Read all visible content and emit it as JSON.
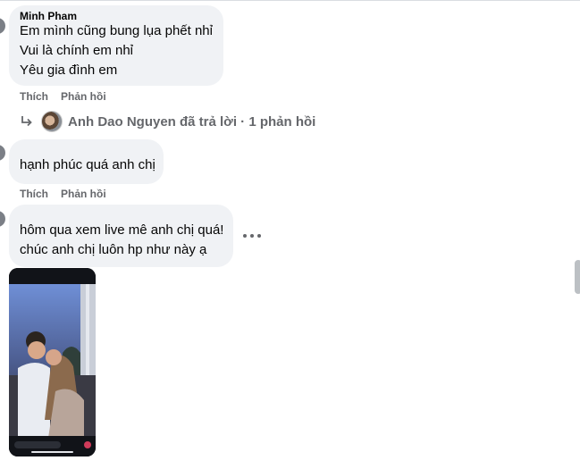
{
  "comments": [
    {
      "author": "Minh Pham",
      "lines": [
        "Em mình cũng bung lụa phết nhỉ",
        "Vui là chính em nhỉ",
        "Yêu gia đình em"
      ],
      "actions": {
        "like": "Thích",
        "reply": "Phản hồi"
      },
      "reply_summary": "Anh Dao Nguyen đã trả lời · 1 phản hồi"
    },
    {
      "author": "",
      "lines": [
        "hạnh phúc quá anh chị"
      ],
      "actions": {
        "like": "Thích",
        "reply": "Phản hồi"
      }
    },
    {
      "author": "",
      "lines": [
        "hôm qua xem live mê anh chị quá!",
        "chúc anh chị luôn hp như này ạ"
      ]
    }
  ],
  "icons": {
    "reply_arrow": "reply-arrow-icon",
    "more": "more-options-icon"
  },
  "colors": {
    "bubble": "#f0f2f5",
    "secondary_text": "#65676b",
    "primary_text": "#050505"
  }
}
